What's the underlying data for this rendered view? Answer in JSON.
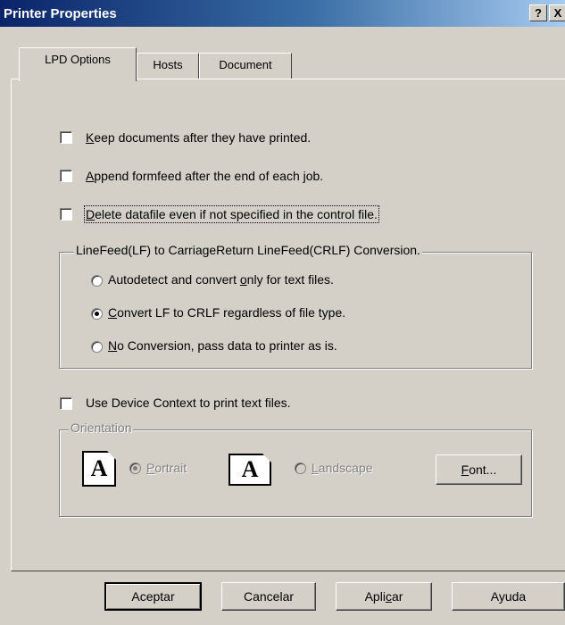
{
  "window": {
    "title": "Printer Properties",
    "help_button": "?",
    "close_button": "X"
  },
  "tabs": [
    {
      "label": "LPD Options",
      "active": true
    },
    {
      "label": "Hosts",
      "active": false
    },
    {
      "label": "Document",
      "active": false
    }
  ],
  "lpd_options": {
    "keep_documents": {
      "mnemonic": "K",
      "rest": "eep documents after they have printed.",
      "checked": false
    },
    "append_formfeed": {
      "mnemonic": "A",
      "rest": "ppend formfeed after the end of each job.",
      "checked": false
    },
    "delete_datafile": {
      "mnemonic": "D",
      "rest": "elete datafile even if not specified in the control file.",
      "checked": false,
      "focused": true
    },
    "conversion_group": {
      "legend": "LineFeed(LF) to CarriageReturn LineFeed(CRLF) Conversion.",
      "options": [
        {
          "pre": "Autodetect and convert ",
          "mnemonic": "o",
          "post": "nly for text files.",
          "selected": false
        },
        {
          "pre": "",
          "mnemonic": "C",
          "post": "onvert LF to CRLF regardless of file type.",
          "selected": true
        },
        {
          "pre": "",
          "mnemonic": "N",
          "post": "o Conversion, pass data to printer as is.",
          "selected": false
        }
      ]
    },
    "use_device_context": {
      "label": "Use Device Context to print text files.",
      "checked": false
    },
    "orientation_group": {
      "legend": "Orientation",
      "enabled": false,
      "portrait": {
        "mnemonic": "P",
        "rest": "ortrait",
        "selected": true,
        "icon_letter": "A"
      },
      "landscape": {
        "mnemonic": "L",
        "rest": "andscape",
        "selected": false,
        "icon_letter": "A"
      },
      "font_button": {
        "mnemonic": "F",
        "rest": "ont..."
      }
    }
  },
  "footer_buttons": {
    "ok": "Aceptar",
    "cancel": "Cancelar",
    "apply_pre": "Apli",
    "apply_mnemonic": "c",
    "apply_post": "ar",
    "help": "Ayuda"
  },
  "colors": {
    "face": "#d4d0c8",
    "title_start": "#0a246a",
    "title_end": "#a6caf0",
    "disabled_text": "#808080"
  }
}
